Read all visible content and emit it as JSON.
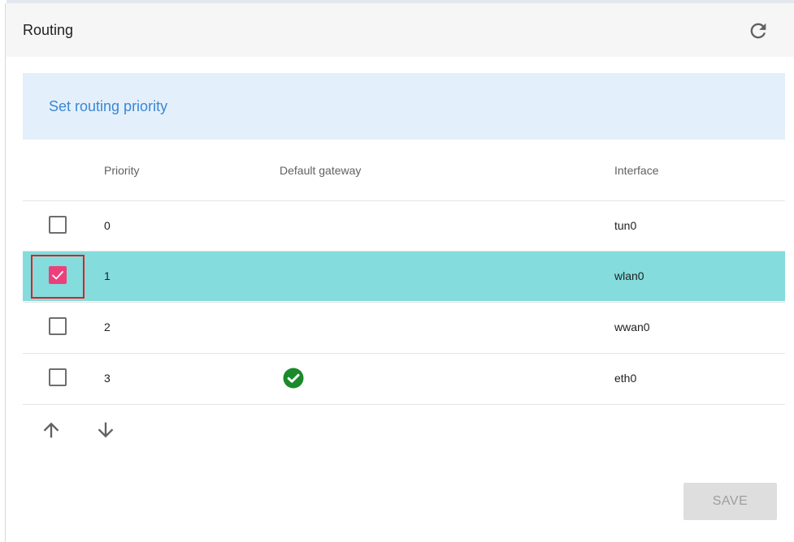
{
  "card": {
    "title": "Routing",
    "refresh_icon": "refresh-icon"
  },
  "banner": {
    "text": "Set routing priority"
  },
  "table": {
    "columns": {
      "priority": "Priority",
      "gateway": "Default gateway",
      "interface": "Interface"
    },
    "rows": [
      {
        "priority": "0",
        "interface": "tun0",
        "checked": false,
        "default_gateway": false
      },
      {
        "priority": "1",
        "interface": "wlan0",
        "checked": true,
        "default_gateway": false
      },
      {
        "priority": "2",
        "interface": "wwan0",
        "checked": false,
        "default_gateway": false
      },
      {
        "priority": "3",
        "interface": "eth0",
        "checked": false,
        "default_gateway": true
      }
    ]
  },
  "controls": {
    "move_up_icon": "arrow-up-icon",
    "move_down_icon": "arrow-down-icon",
    "save_label": "SAVE"
  },
  "colors": {
    "selected_row": "#84dcdd",
    "checkbox_checked": "#ec407a",
    "banner_background": "#e3f0fb",
    "banner_text": "#3b87d3",
    "gateway_ok": "#1b8a2a",
    "save_disabled": "#dedede"
  }
}
